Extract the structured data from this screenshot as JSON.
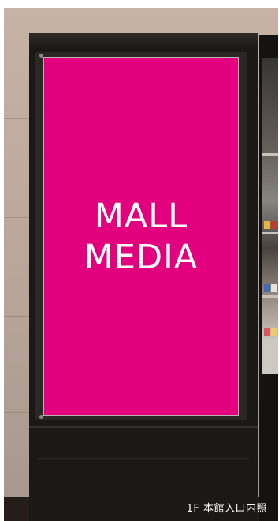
{
  "screen": {
    "line1": "MALL",
    "line2": "MEDIA",
    "color": "#e3007f"
  },
  "caption": "1F 本館入口内照"
}
